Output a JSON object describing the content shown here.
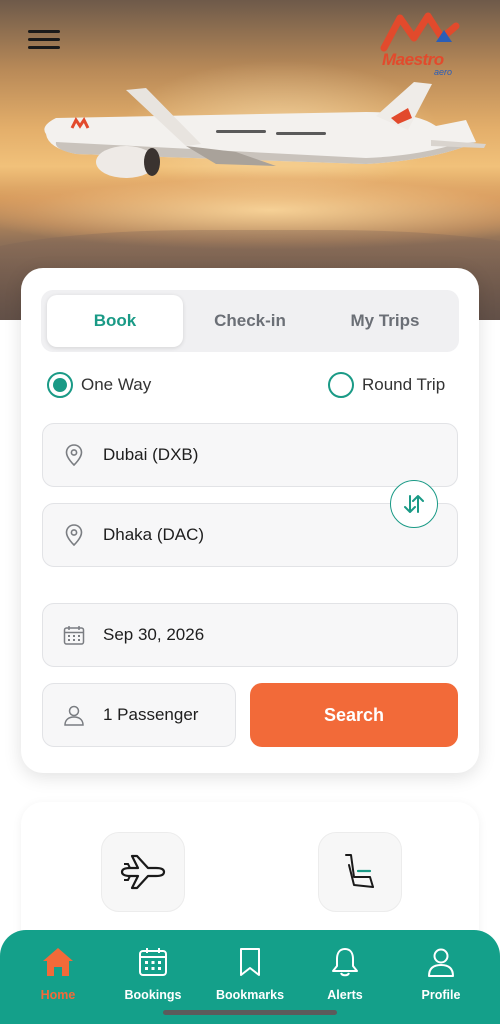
{
  "header": {
    "brand_name": "Maestro",
    "brand_sub": "aero"
  },
  "booking": {
    "tabs": [
      {
        "label": "Book",
        "active": true
      },
      {
        "label": "Check-in",
        "active": false
      },
      {
        "label": "My Trips",
        "active": false
      }
    ],
    "trip_type": {
      "one_way": "One Way",
      "round_trip": "Round Trip",
      "selected": "one_way"
    },
    "from": "Dubai (DXB)",
    "to": "Dhaka (DAC)",
    "date": "Sep 30, 2026",
    "passengers": "1 Passenger",
    "search_label": "Search"
  },
  "quick_actions": [
    {
      "icon": "airplane-icon"
    },
    {
      "icon": "seat-icon"
    }
  ],
  "bottom_nav": [
    {
      "label": "Home",
      "icon": "home-icon",
      "active": true
    },
    {
      "label": "Bookings",
      "icon": "calendar-icon",
      "active": false
    },
    {
      "label": "Bookmarks",
      "icon": "bookmark-icon",
      "active": false
    },
    {
      "label": "Alerts",
      "icon": "bell-icon",
      "active": false
    },
    {
      "label": "Profile",
      "icon": "profile-icon",
      "active": false
    }
  ],
  "colors": {
    "accent": "#1a9a86",
    "nav_bg": "#14a08a",
    "cta": "#f26a39"
  }
}
